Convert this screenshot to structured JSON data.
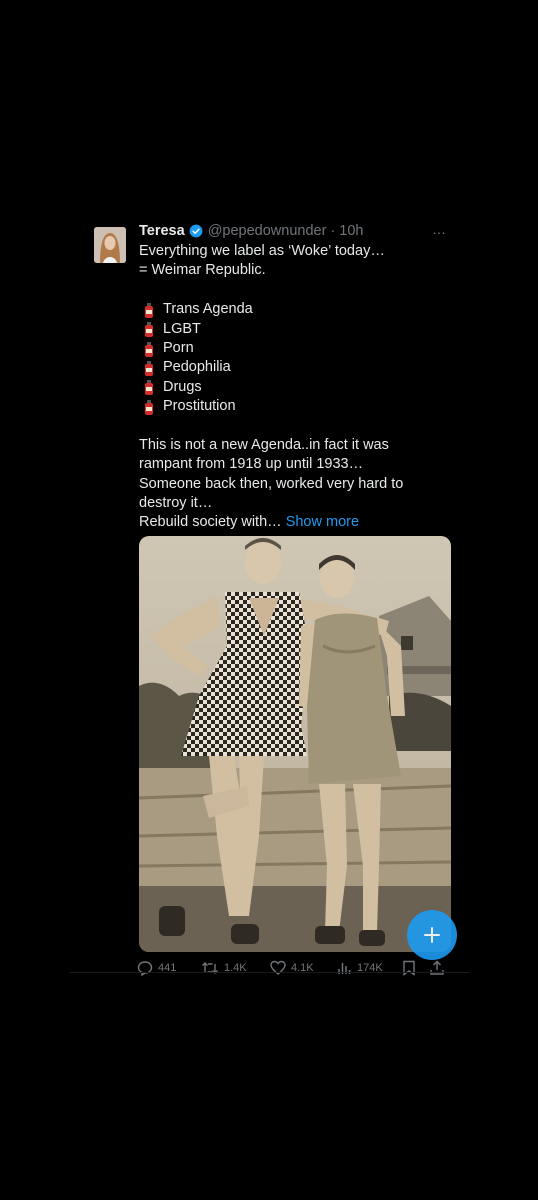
{
  "tweet": {
    "author_name": "Teresa",
    "handle_time": "@pepedownunder · 10h",
    "more_icon": "…",
    "text_lines": [
      "Everything we label as ‘Woke’ today…",
      "= Weimar Republic."
    ],
    "list_items": [
      "Trans Agenda",
      "LGBT",
      "Porn",
      "Pedophilia",
      "Drugs",
      "Prostitution"
    ],
    "paragraph_lines": [
      "This is not a new Agenda..in fact it was",
      "rampant from 1918 up until 1933…",
      "Someone back then, worked very hard to",
      "destroy it…"
    ],
    "last_line": "Rebuild society with…",
    "show_more": "Show more"
  },
  "actions": {
    "replies": "441",
    "retweets": "1.4K",
    "likes": "4.1K",
    "views": "174K"
  },
  "icons": {
    "list_bullet": "fire-extinguisher-icon",
    "verified": "verified-badge-icon",
    "fab": "compose-plus-icon"
  },
  "colors": {
    "background": "#000000",
    "text": "#e7e9ea",
    "muted": "#71767b",
    "accent": "#1d9bf0"
  }
}
